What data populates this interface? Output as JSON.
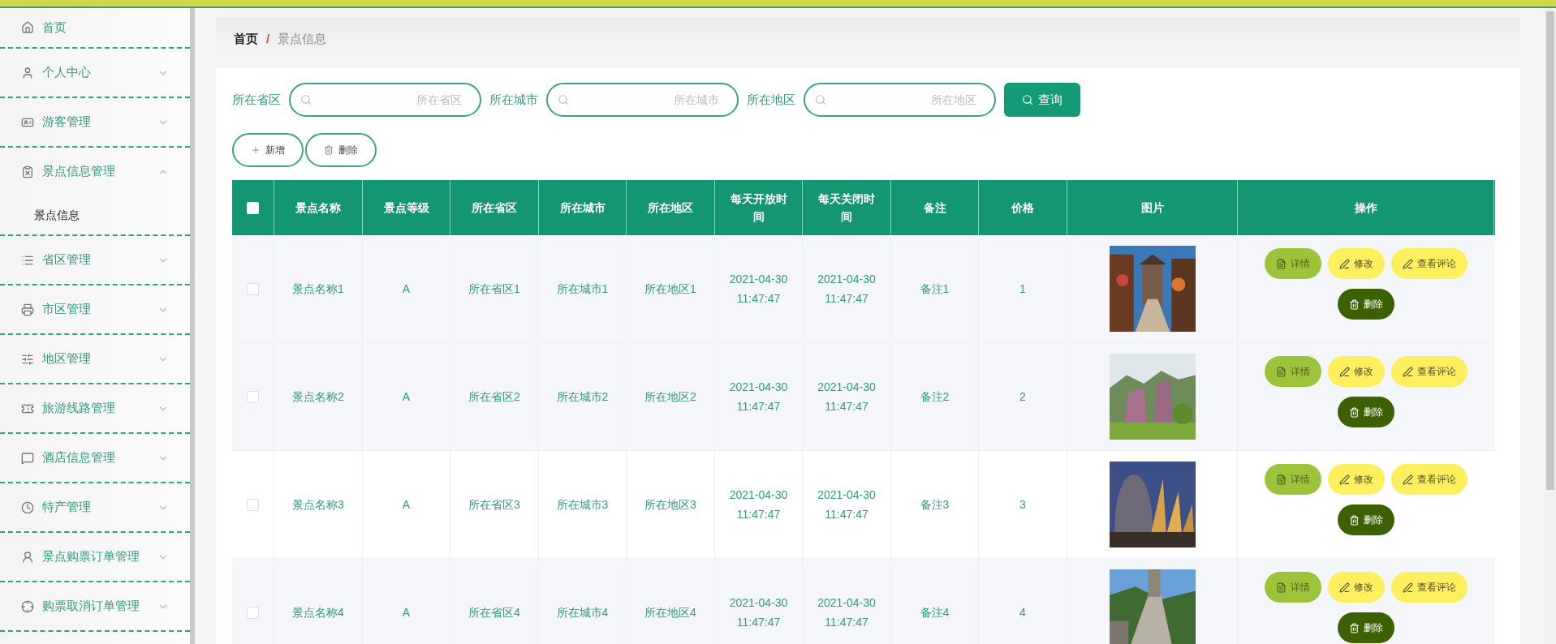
{
  "sidebar": {
    "items": [
      {
        "label": "首页",
        "kind": "link"
      },
      {
        "label": "个人中心",
        "kind": "menu",
        "expanded": false
      },
      {
        "label": "游客管理",
        "kind": "menu",
        "expanded": false
      },
      {
        "label": "景点信息管理",
        "kind": "menu",
        "expanded": true,
        "children": [
          {
            "label": "景点信息"
          }
        ]
      },
      {
        "label": "省区管理",
        "kind": "menu",
        "expanded": false
      },
      {
        "label": "市区管理",
        "kind": "menu",
        "expanded": false
      },
      {
        "label": "地区管理",
        "kind": "menu",
        "expanded": false
      },
      {
        "label": "旅游线路管理",
        "kind": "menu",
        "expanded": false
      },
      {
        "label": "酒店信息管理",
        "kind": "menu",
        "expanded": false
      },
      {
        "label": "特产管理",
        "kind": "menu",
        "expanded": false
      },
      {
        "label": "景点购票订单管理",
        "kind": "menu",
        "expanded": false
      },
      {
        "label": "购票取消订单管理",
        "kind": "menu",
        "expanded": false
      }
    ]
  },
  "breadcrumb": {
    "items": [
      "首页",
      "景点信息"
    ],
    "separator": "/"
  },
  "search": {
    "fields": [
      {
        "label": "所在省区",
        "placeholder": "所在省区"
      },
      {
        "label": "所在城市",
        "placeholder": "所在城市"
      },
      {
        "label": "所在地区",
        "placeholder": "所在地区"
      }
    ],
    "button": "查询"
  },
  "toolbar": [
    {
      "label": "新增",
      "kind": "add"
    },
    {
      "label": "删除",
      "kind": "delete"
    }
  ],
  "table": {
    "select_all": false,
    "columns": [
      "景点名称",
      "景点等级",
      "所在省区",
      "所在城市",
      "所在地区",
      "每天开放时间",
      "每天关闭时间",
      "备注",
      "价格",
      "图片",
      "操作"
    ],
    "rows": [
      {
        "checked": false,
        "cells": [
          "景点名称1",
          "A",
          "所在省区1",
          "所在城市1",
          "所在地区1",
          "2021-04-30 11:47:47",
          "2021-04-30 11:47:47",
          "备注1",
          "1"
        ],
        "actions": [
          {
            "label": "详情",
            "kind": "detail"
          },
          {
            "label": "修改",
            "kind": "edit"
          },
          {
            "label": "查看评论",
            "kind": "edit"
          },
          {
            "label": "删除",
            "kind": "delete"
          }
        ]
      },
      {
        "checked": false,
        "cells": [
          "景点名称2",
          "A",
          "所在省区2",
          "所在城市2",
          "所在地区2",
          "2021-04-30 11:47:47",
          "2021-04-30 11:47:47",
          "备注2",
          "2"
        ],
        "actions": [
          {
            "label": "详情",
            "kind": "detail"
          },
          {
            "label": "修改",
            "kind": "edit"
          },
          {
            "label": "查看评论",
            "kind": "edit"
          },
          {
            "label": "删除",
            "kind": "delete"
          }
        ]
      },
      {
        "checked": false,
        "cells": [
          "景点名称3",
          "A",
          "所在省区3",
          "所在城市3",
          "所在地区3",
          "2021-04-30 11:47:47",
          "2021-04-30 11:47:47",
          "备注3",
          "3"
        ],
        "actions": [
          {
            "label": "详情",
            "kind": "detail"
          },
          {
            "label": "修改",
            "kind": "edit"
          },
          {
            "label": "查看评论",
            "kind": "edit"
          },
          {
            "label": "删除",
            "kind": "delete"
          }
        ]
      },
      {
        "checked": false,
        "cells": [
          "景点名称4",
          "A",
          "所在省区4",
          "所在城市4",
          "所在地区4",
          "2021-04-30 11:47:47",
          "2021-04-30 11:47:47",
          "备注4",
          "4"
        ],
        "actions": [
          {
            "label": "详情",
            "kind": "detail"
          },
          {
            "label": "修改",
            "kind": "edit"
          },
          {
            "label": "查看评论",
            "kind": "edit"
          },
          {
            "label": "删除",
            "kind": "delete"
          }
        ]
      }
    ]
  }
}
